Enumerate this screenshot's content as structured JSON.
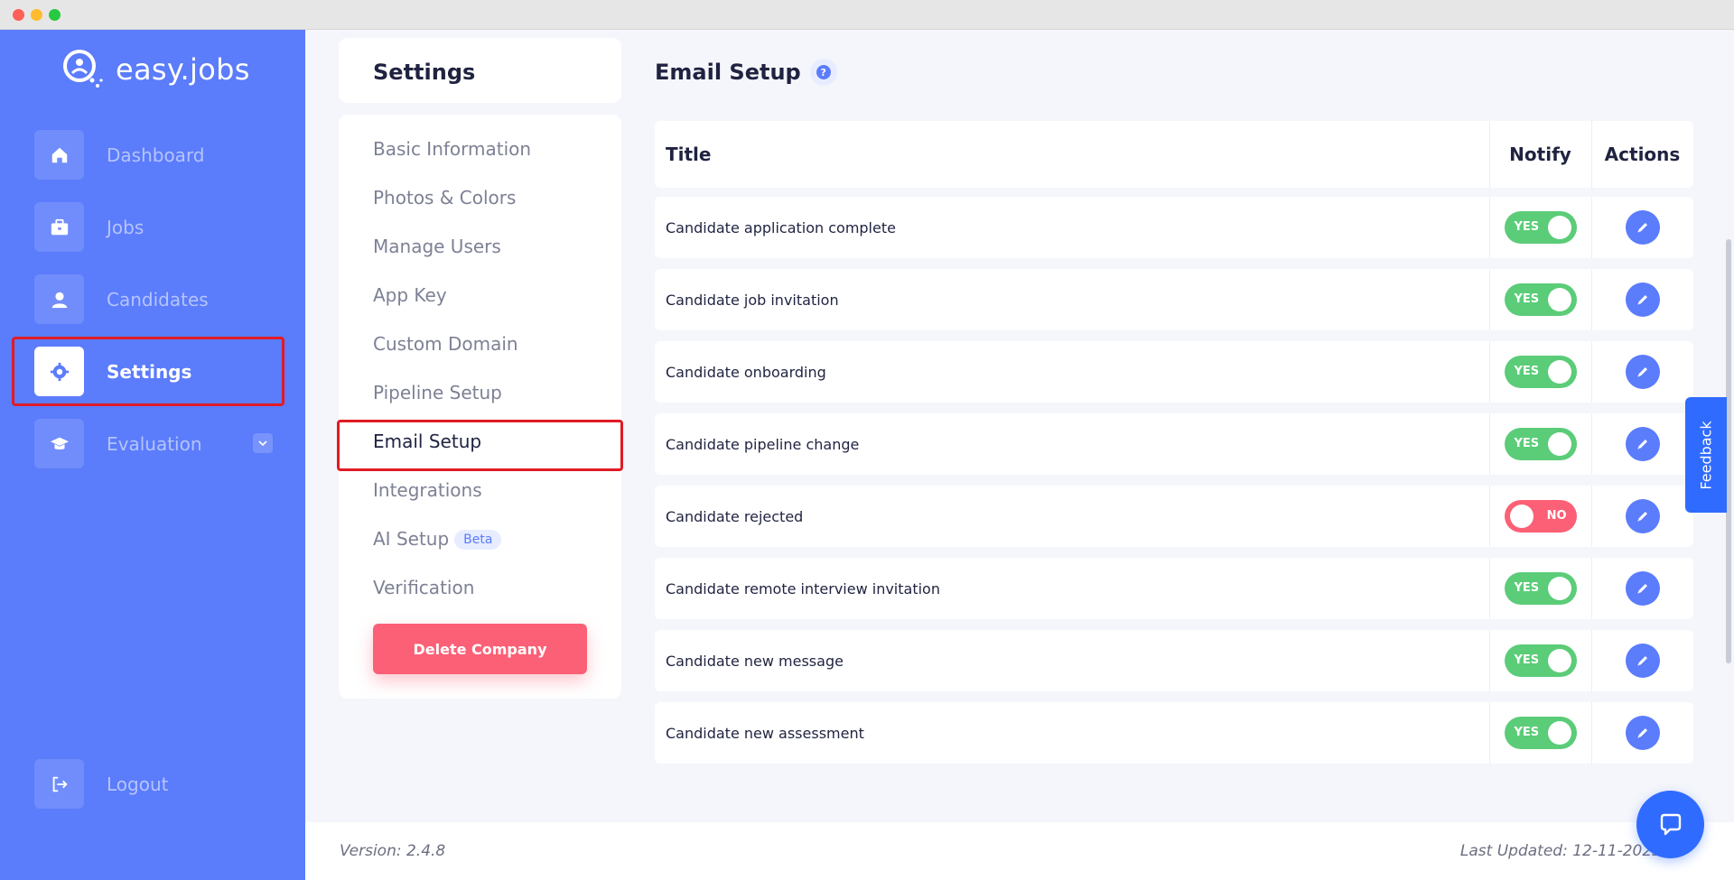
{
  "app": {
    "brand": "easy.jobs",
    "accent": "#5b7cfb",
    "danger": "#fc6076",
    "success": "#5bcc78"
  },
  "sidebar": {
    "items": [
      {
        "label": "Dashboard",
        "icon": "home-icon"
      },
      {
        "label": "Jobs",
        "icon": "briefcase-icon"
      },
      {
        "label": "Candidates",
        "icon": "user-icon"
      },
      {
        "label": "Settings",
        "icon": "gear-icon",
        "active": true
      },
      {
        "label": "Evaluation",
        "icon": "graduation-cap-icon",
        "expandable": true
      }
    ],
    "logout": "Logout"
  },
  "settings": {
    "heading": "Settings",
    "menu": [
      {
        "label": "Basic Information"
      },
      {
        "label": "Photos & Colors"
      },
      {
        "label": "Manage Users"
      },
      {
        "label": "App Key"
      },
      {
        "label": "Custom Domain"
      },
      {
        "label": "Pipeline Setup"
      },
      {
        "label": "Email Setup",
        "active": true
      },
      {
        "label": "Integrations"
      },
      {
        "label": "AI Setup",
        "badge": "Beta"
      },
      {
        "label": "Verification"
      }
    ],
    "delete_button": "Delete Company"
  },
  "main": {
    "title": "Email Setup",
    "help_icon": "question-circle-icon",
    "table": {
      "headers": {
        "title": "Title",
        "notify": "Notify",
        "actions": "Actions"
      },
      "rows": [
        {
          "title": "Candidate application complete",
          "notify": "YES"
        },
        {
          "title": "Candidate job invitation",
          "notify": "YES"
        },
        {
          "title": "Candidate onboarding",
          "notify": "YES"
        },
        {
          "title": "Candidate pipeline change",
          "notify": "YES"
        },
        {
          "title": "Candidate rejected",
          "notify": "NO"
        },
        {
          "title": "Candidate remote interview invitation",
          "notify": "YES"
        },
        {
          "title": "Candidate new message",
          "notify": "YES"
        },
        {
          "title": "Candidate new assessment",
          "notify": "YES"
        }
      ]
    }
  },
  "footer": {
    "version": "Version: 2.4.8",
    "last_updated": "Last Updated: 12-11-2023"
  },
  "feedback": "Feedback"
}
